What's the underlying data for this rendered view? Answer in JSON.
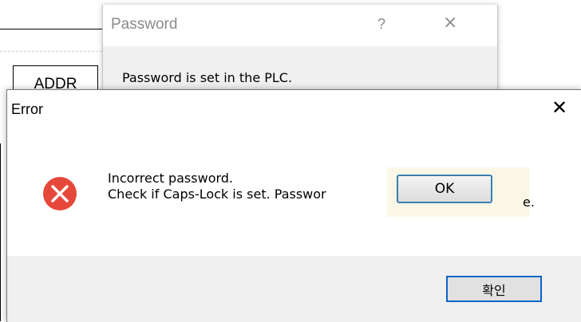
{
  "background_app": {
    "field_label": "ADDR"
  },
  "password_dialog": {
    "title": "Password",
    "help_label": "?",
    "close_label": "×",
    "message": "Password is set in the PLC."
  },
  "error_dialog": {
    "title": "Error",
    "close_label": "✕",
    "icon": "error-x-circle-icon",
    "message_line1": "Incorrect password.",
    "message_line2": "Check if Caps-Lock is set. Passwor",
    "confirm_label": "확인"
  },
  "ok_overlay": {
    "ok_label": "OK",
    "tail_text": "e."
  },
  "colors": {
    "error_icon_red": "#e5483b",
    "focus_border_blue": "#0a64c8",
    "footer_gray": "#f0f0f0"
  }
}
